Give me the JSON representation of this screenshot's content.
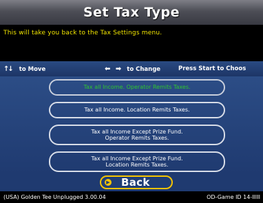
{
  "header": {
    "title": "Set Tax Type"
  },
  "description": {
    "text": "This will take you back to the Tax Settings menu."
  },
  "help_bar": {
    "move_label": "to Move",
    "change_label": "to Change",
    "start_label": "Press Start to Choos",
    "move_icon": "up-down-arrows-icon",
    "change_icon": "left-right-arrows-icon"
  },
  "menu": {
    "options": [
      {
        "lines": [
          "Tax all Income. Operator Remits Taxes."
        ],
        "selected": true
      },
      {
        "lines": [
          "Tax all Income. Location Remits Taxes."
        ],
        "selected": false
      },
      {
        "lines": [
          "Tax all Income Except Prize Fund.",
          "Operator Remits Taxes."
        ],
        "selected": false
      },
      {
        "lines": [
          "Tax all Income Except Prize Fund.",
          "Location Remits Taxes."
        ],
        "selected": false
      }
    ]
  },
  "back": {
    "label": "Back",
    "icon": "play-arrow-icon"
  },
  "footer": {
    "left": "(USA) Golden Tee Unplugged 3.00.04",
    "right": "OD-Game ID 14-IIIII"
  },
  "colors": {
    "description_text": "#f2e600",
    "selected_option_text": "#2fc62f",
    "panel_blue": "#1f3a70",
    "back_border": "#f5c400"
  }
}
